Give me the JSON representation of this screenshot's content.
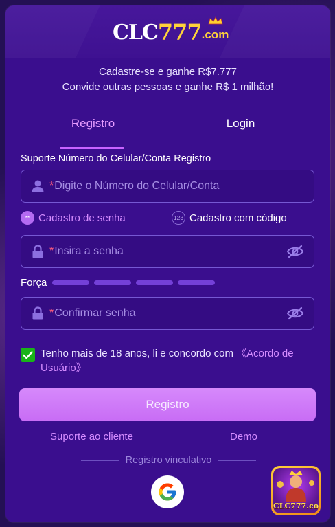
{
  "brand": {
    "logo_prefix": "CLC",
    "logo_digits": "777",
    "logo_suffix": ".com"
  },
  "promo": {
    "line1": "Cadastre-se e ganhe R$7.777",
    "line2": "Convide outras pessoas e ganhe R$ 1 milhão!"
  },
  "tabs": {
    "register": "Registro",
    "login": "Login"
  },
  "form": {
    "caption": "Suporte Número do Celular/Conta Registro",
    "required_mark": "*",
    "phone_placeholder": "Digite o Número do Celular/Conta",
    "mode_password": "Cadastro de senha",
    "mode_password_mark": "**",
    "mode_code": "Cadastro com código",
    "mode_code_mark": "123",
    "password_placeholder": "Insira a senha",
    "strength_label": "Força",
    "confirm_placeholder": "Confirmar senha",
    "agree_text": "Tenho mais de 18 anos, li e concordo com ",
    "agree_link": "《Acordo de Usuário》",
    "agree_checked": true,
    "submit_label": "Registro"
  },
  "footer": {
    "support_link": "Suporte ao cliente",
    "demo_link": "Demo",
    "divider_text": "Registro vinculativo"
  },
  "app_badge": {
    "name": "CLC777.com"
  },
  "colors": {
    "modal_bg": "#3a0e8e",
    "accent": "#d58cff",
    "button": "#c86cf5",
    "checkbox": "#19b319"
  },
  "icons": {
    "user": "user-icon",
    "lock": "lock-icon",
    "eye_hidden": "eye-off-icon",
    "check": "check-icon",
    "google": "google-icon"
  }
}
